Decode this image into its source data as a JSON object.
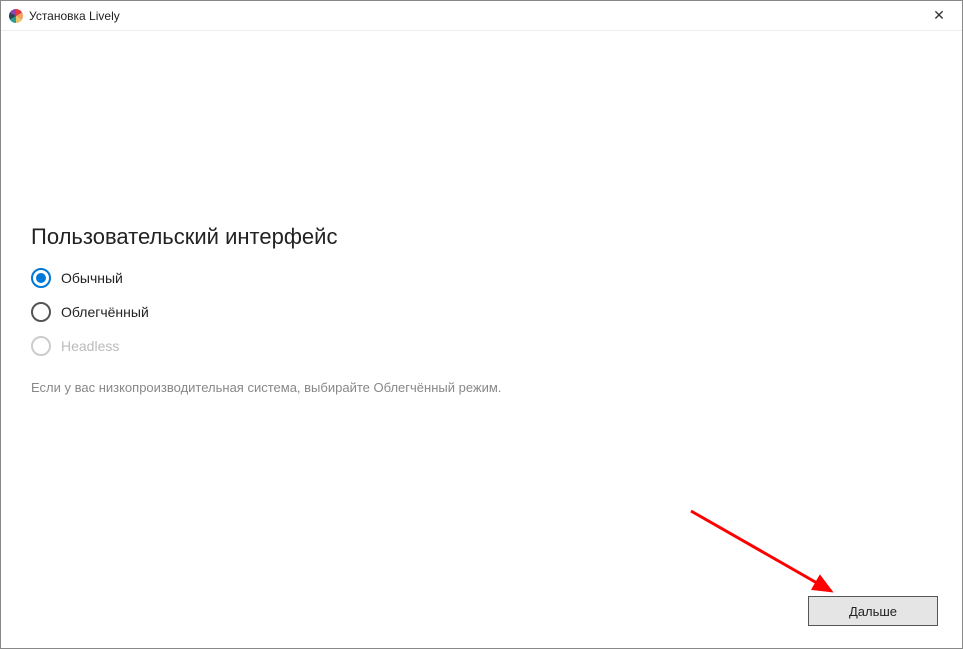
{
  "titlebar": {
    "title": "Установка Lively",
    "close": "✕"
  },
  "main": {
    "heading": "Пользовательский интерфейс",
    "options": [
      {
        "label": "Обычный",
        "selected": true,
        "disabled": false
      },
      {
        "label": "Облегчённый",
        "selected": false,
        "disabled": false
      },
      {
        "label": "Headless",
        "selected": false,
        "disabled": true
      }
    ],
    "hint": "Если у вас низкопроизводительная система, выбирайте Облегчённый режим."
  },
  "footer": {
    "next_label": "Дальше"
  }
}
